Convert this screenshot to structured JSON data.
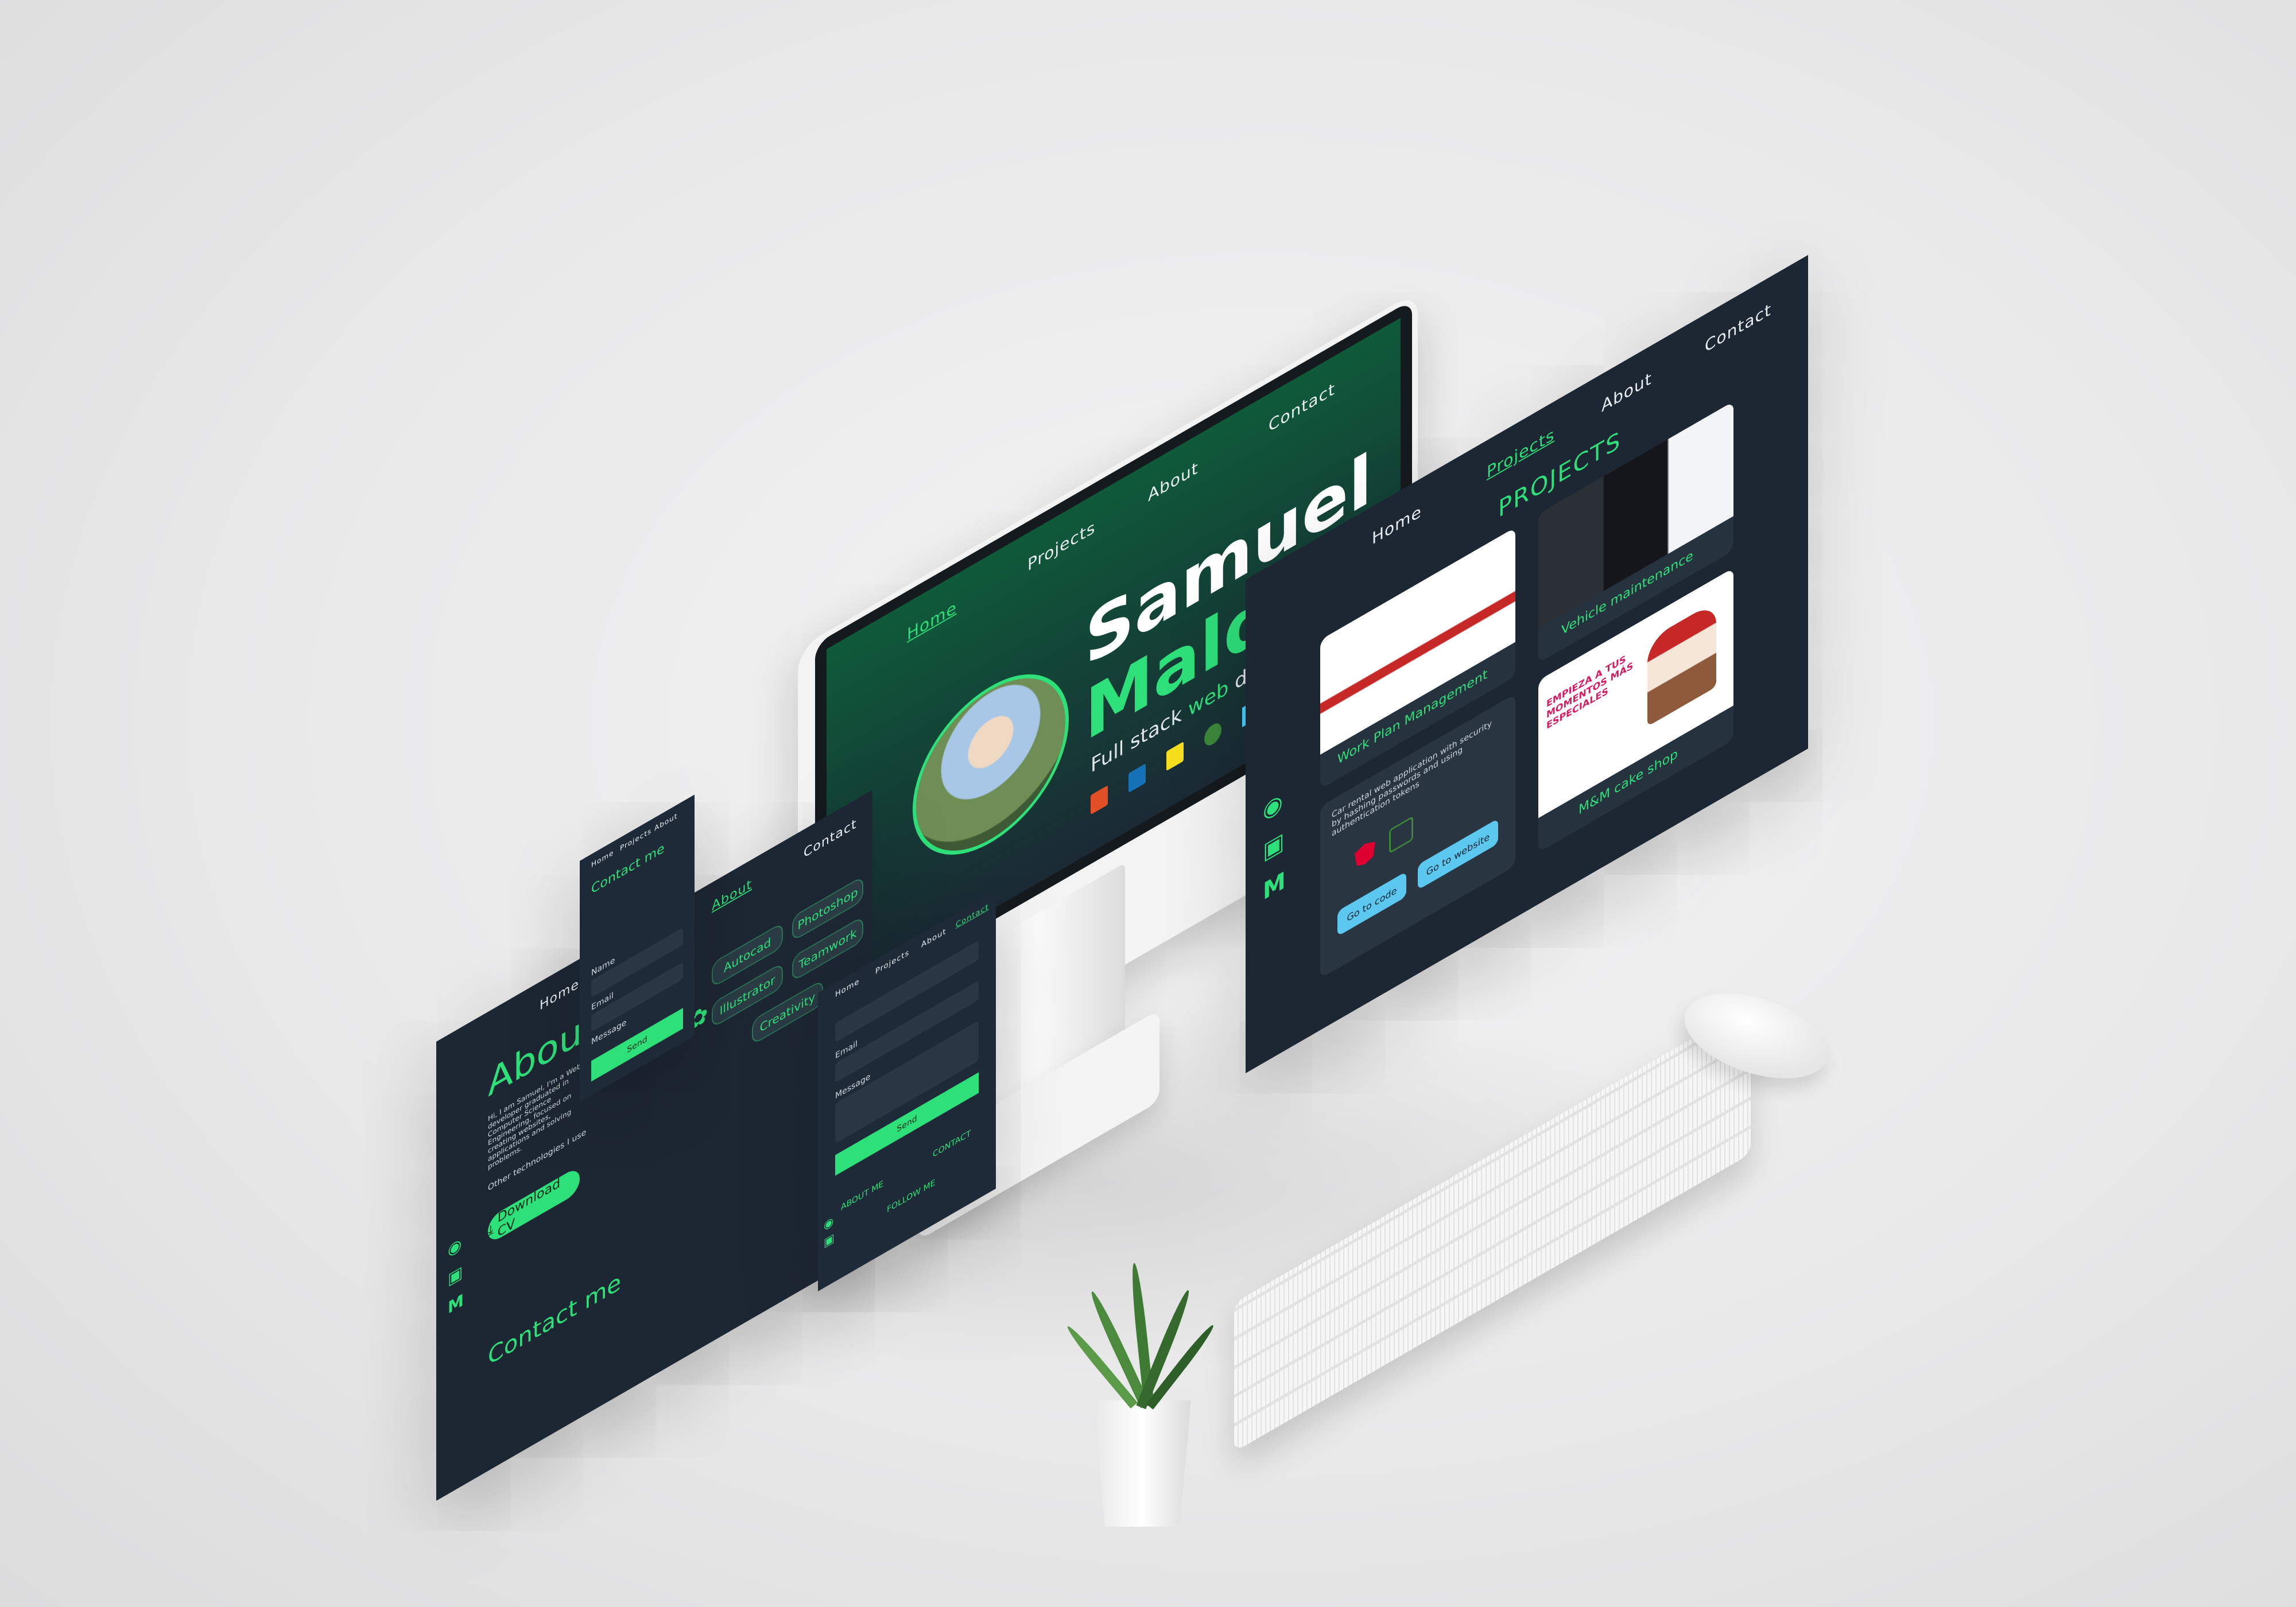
{
  "nav": {
    "home": "Home",
    "projects": "Projects",
    "about": "About",
    "contact": "Contact"
  },
  "hero": {
    "first_name": "Samuel",
    "last_name": "Maldonado",
    "subtitle_pre": "Full stack ",
    "subtitle_web": "web",
    "subtitle_post": " developer"
  },
  "projects": {
    "heading": "PROJECTS",
    "cards": [
      {
        "title": "Work Plan Management"
      },
      {
        "title": "Vehicle maintenance"
      },
      {
        "title": "M&M cake shop"
      }
    ],
    "detail_text": "Car rental web application with security by hashing passwords and using authentication tokens",
    "go_to_code": "Go to code",
    "go_to_website": "Go to website",
    "cake_banner": "EMPIEZA A TUS MOMENTOS MÁS ESPECIALES"
  },
  "about": {
    "heading": "About",
    "intro": "Hi, I am Samuel, I'm a Web developer graduated in Computer Science Engineering, focused on creating websites, applications and solving problems.",
    "other_tech": "Other technologies I use",
    "download_cv": "Download CV",
    "contact_heading": "Contact me"
  },
  "about_skills": {
    "tags": [
      "Autocad",
      "Photoshop",
      "Illustrator",
      "Teamwork",
      "Creativity"
    ]
  },
  "contact": {
    "heading": "Contact me",
    "name_label": "Name",
    "email_label": "Email",
    "message_label": "Message",
    "send": "Send"
  },
  "footer": {
    "about_me": "ABOUT ME",
    "contact": "CONTACT",
    "follow_me": "FOLLOW ME"
  },
  "social": [
    "github-icon",
    "linkedin-icon",
    "medium-icon"
  ],
  "colors": {
    "accent": "#2ee07a",
    "panel": "#1d2733",
    "hero_bg": "#0f5a3a"
  }
}
